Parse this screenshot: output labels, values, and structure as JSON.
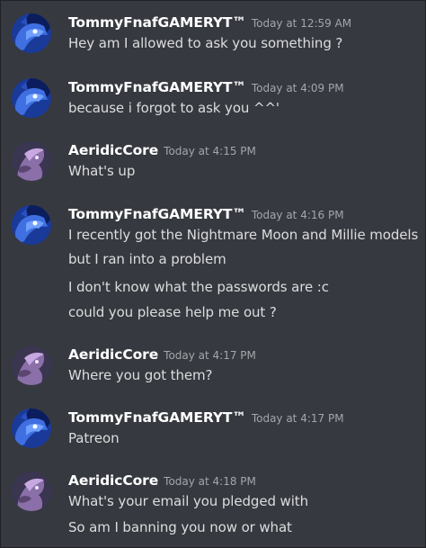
{
  "users": {
    "tommy": "TommyFnafGAMERYT™",
    "aeridic": "AeridicCore"
  },
  "messages": [
    {
      "author": "TommyFnafGAMERYT™",
      "time": "Today at 12:59 AM",
      "lines": [
        "Hey am I allowed to ask you something ?"
      ]
    },
    {
      "author": "TommyFnafGAMERYT™",
      "time": "Today at 4:09 PM",
      "lines": [
        "because i forgot to ask you ^^'"
      ]
    },
    {
      "author": "AeridicCore",
      "time": "Today at 4:15 PM",
      "lines": [
        "What's up"
      ]
    },
    {
      "author": "TommyFnafGAMERYT™",
      "time": "Today at 4:16 PM",
      "lines": [
        "I recently got the Nightmare Moon and Millie models",
        "but I ran into a problem",
        "I don't know what the passwords are :c",
        "could you please help me out ?"
      ]
    },
    {
      "author": "AeridicCore",
      "time": "Today at 4:17 PM",
      "lines": [
        "Where you got them?"
      ]
    },
    {
      "author": "TommyFnafGAMERYT™",
      "time": "Today at 4:17 PM",
      "lines": [
        "Patreon"
      ]
    },
    {
      "author": "AeridicCore",
      "time": "Today at 4:18 PM",
      "lines": [
        "What's your email you pledged with",
        "So am I banning you now or what"
      ]
    }
  ],
  "colors": {
    "background": "#36393f",
    "username": "#ffffff",
    "timestamp": "#a3a6aa",
    "message_text": "#dcddde"
  },
  "icons": {
    "tommy_avatar": "blue-wolf-avatar-icon",
    "aeridic_avatar": "purple-pony-avatar-icon"
  }
}
